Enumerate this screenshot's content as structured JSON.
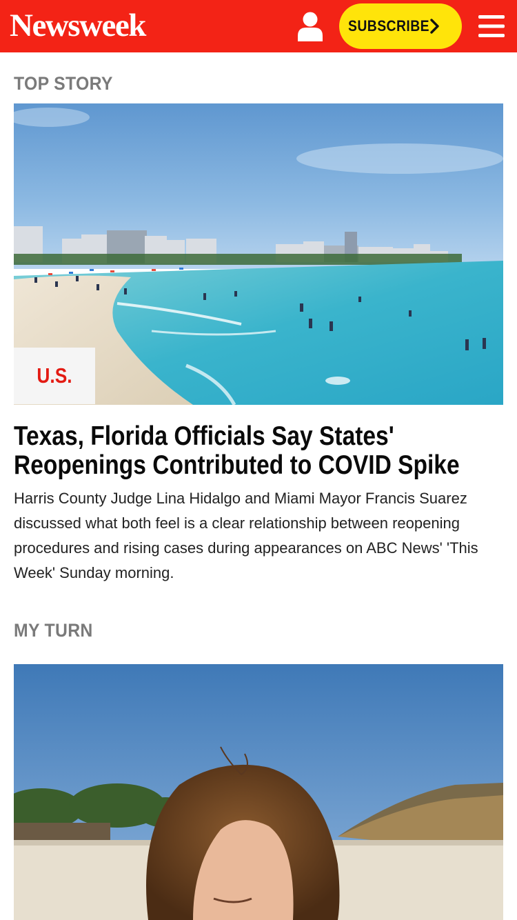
{
  "header": {
    "logo": "Newsweek",
    "subscribe_label": "SUBSCRIBE",
    "icons": {
      "account": "user-icon",
      "subscribe_arrow": "chevron-right-icon",
      "menu": "hamburger-menu-icon"
    },
    "colors": {
      "brand_red": "#f32316",
      "subscribe_yellow": "#ffe40a"
    }
  },
  "top_story": {
    "section_label": "TOP STORY",
    "category": "U.S.",
    "headline": "Texas, Florida Officials Say States' Reopenings Contributed to COVID Spike",
    "summary": "Harris County Judge Lina Hidalgo and Miami Mayor Francis Suarez discussed what both feel is a clear relationship between reopening procedures and rising cases during appearances on ABC News' 'This Week' Sunday morning.",
    "image": "beach-crowd-photo"
  },
  "my_turn": {
    "section_label": "MY TURN",
    "image": "woman-on-beach-photo"
  }
}
